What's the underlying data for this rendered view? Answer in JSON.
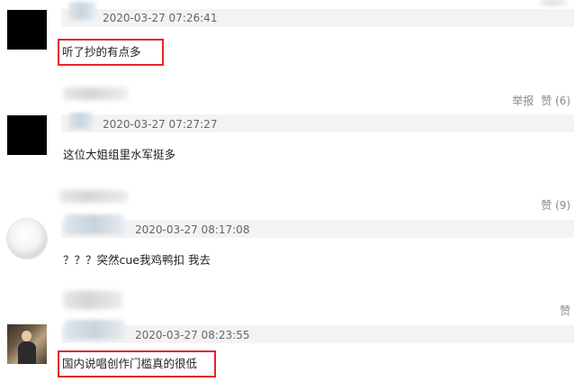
{
  "comments": [
    {
      "timestamp": "2020-03-27 07:26:41",
      "text": "听了抄的有点多",
      "actions": {
        "report": "举报",
        "like": "赞 (6)"
      }
    },
    {
      "timestamp": "2020-03-27 07:27:27",
      "text": "这位大姐组里水军挺多",
      "actions": {
        "like": "赞 (9)"
      }
    },
    {
      "timestamp": "2020-03-27 08:17:08",
      "text": "？？？突然cue我鸡鸭扣 我去",
      "actions": {
        "like": "赞"
      }
    },
    {
      "timestamp": "2020-03-27 08:23:55",
      "text": "国内说唱创作门槛真的很低"
    }
  ],
  "colors": {
    "highlight_border": "#e52429",
    "meta_bar": "#f3f3f3",
    "action_text": "#8a8a8a"
  },
  "icons": {
    "avatar_1": "black-square-avatar",
    "avatar_2": "black-square-avatar",
    "avatar_3": "white-plate-avatar",
    "avatar_4": "person-photo-avatar"
  }
}
